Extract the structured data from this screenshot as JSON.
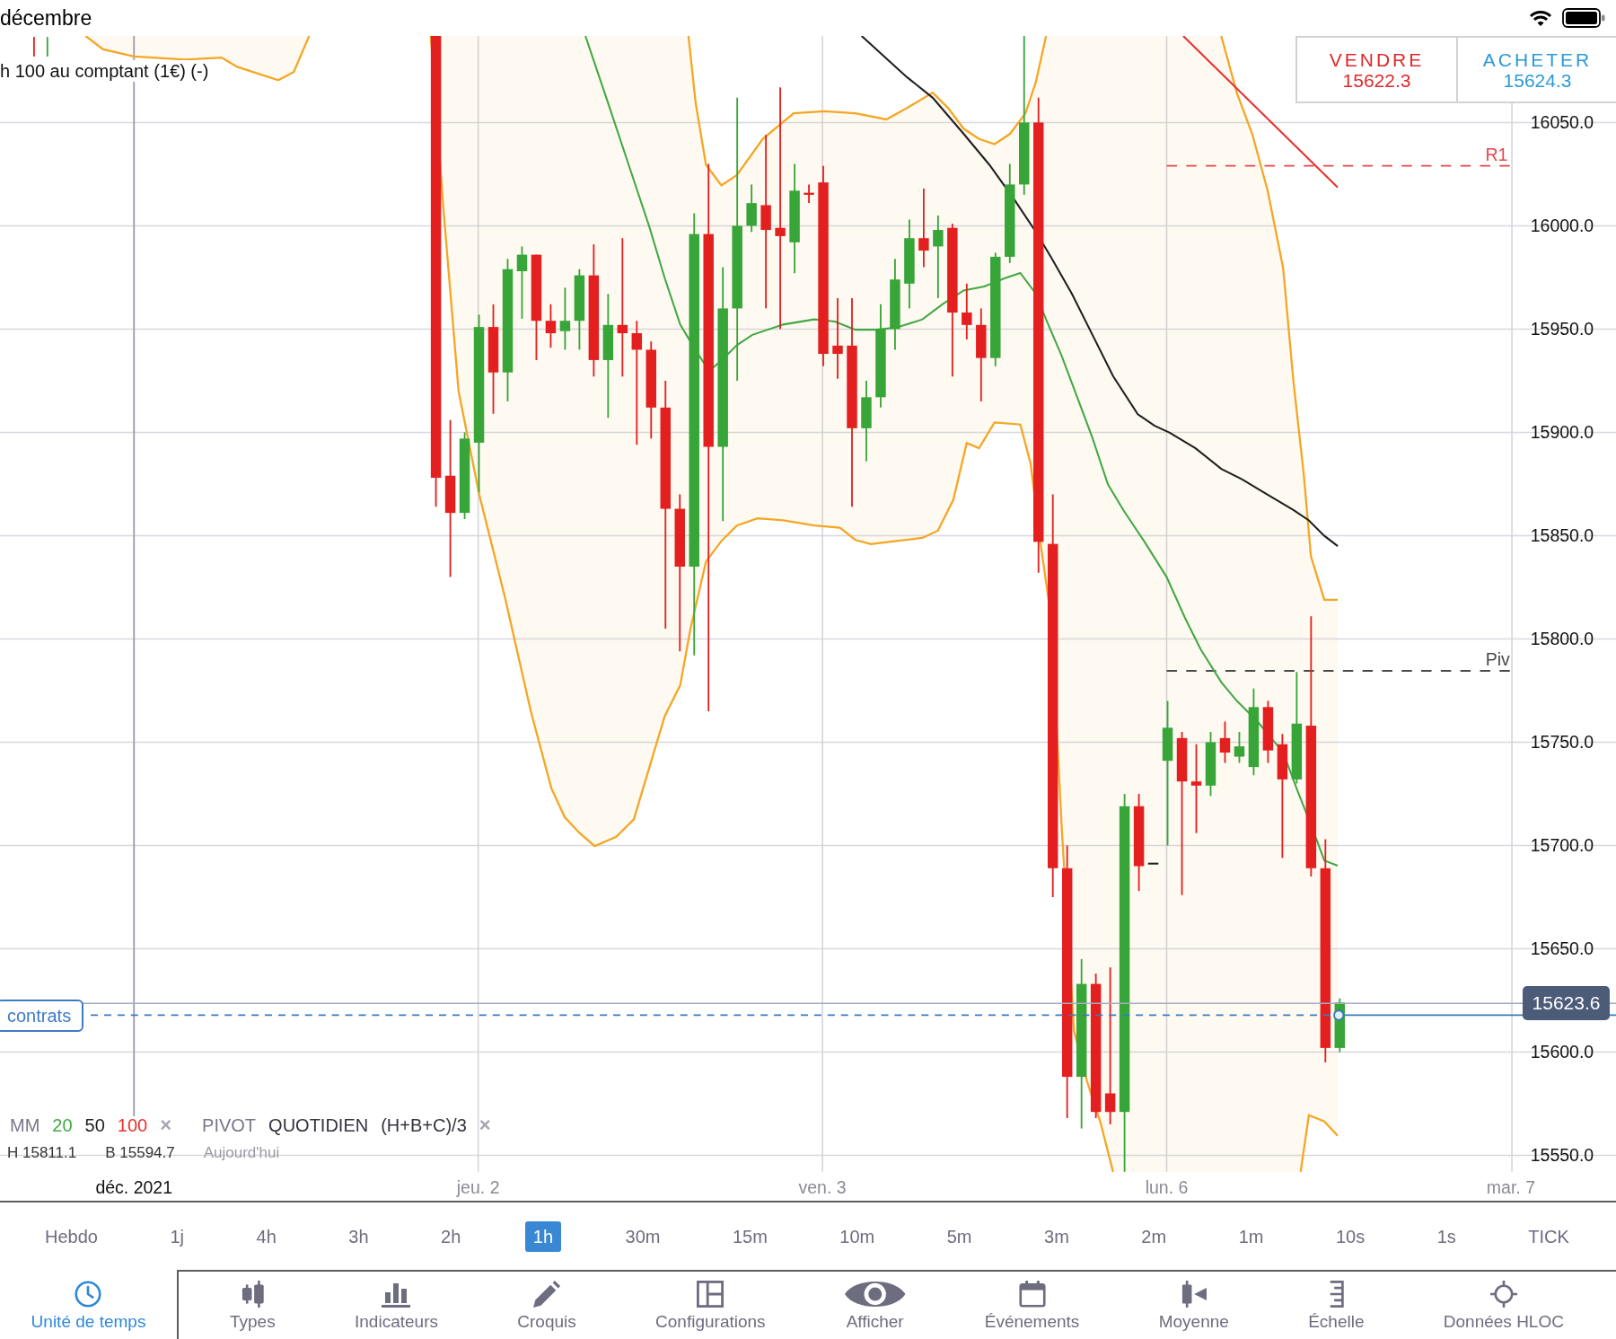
{
  "status_bar": {
    "title": "décembre"
  },
  "chart": {
    "instrument": "h 100 au comptant (1€) (-)",
    "quotes": [
      {
        "kind": "sell",
        "label": "VENDRE",
        "price": "15622.3"
      },
      {
        "kind": "buy",
        "label": "ACHETER",
        "price": "15624.3"
      }
    ],
    "price_axis": [
      "16050.0",
      "16000.0",
      "15950.0",
      "15900.0",
      "15850.0",
      "15800.0",
      "15750.0",
      "15700.0",
      "15650.0",
      "15600.0",
      "15550.0"
    ],
    "pivot_lines": [
      {
        "label": "R1",
        "color": "#e5484d"
      },
      {
        "label": "Piv",
        "color": "#4a4a4a"
      }
    ],
    "last_price": "15623.6",
    "position": {
      "label": "contrats"
    },
    "indicators": [
      {
        "label": "MM",
        "params": [
          {
            "text": "20",
            "color": "#43a843"
          },
          {
            "text": "50",
            "color": "#1f1f1f"
          },
          {
            "text": "100",
            "color": "#e8312f"
          }
        ],
        "remove": "×"
      },
      {
        "label": "PIVOT",
        "params": [
          {
            "text": "QUOTIDIEN"
          },
          {
            "text": "(H+B+C)/3"
          }
        ],
        "remove": "×"
      }
    ],
    "stats": [
      {
        "kind": "value",
        "text": "H 15811.1"
      },
      {
        "kind": "value",
        "text": "B 15594.7"
      },
      {
        "kind": "period",
        "text": "Aujourd'hui"
      }
    ],
    "time_axis": [
      {
        "kind": "month",
        "label": "déc. 2021"
      },
      {
        "kind": "day",
        "label": "jeu. 2"
      },
      {
        "kind": "day",
        "label": "ven. 3"
      },
      {
        "kind": "day",
        "label": "lun. 6"
      },
      {
        "kind": "day",
        "label": "mar. 7"
      }
    ]
  },
  "timeframes": [
    {
      "label": "Hebdo",
      "selected": false
    },
    {
      "label": "1j",
      "selected": false
    },
    {
      "label": "4h",
      "selected": false
    },
    {
      "label": "3h",
      "selected": false
    },
    {
      "label": "2h",
      "selected": false
    },
    {
      "label": "1h",
      "selected": true
    },
    {
      "label": "30m",
      "selected": false
    },
    {
      "label": "15m",
      "selected": false
    },
    {
      "label": "10m",
      "selected": false
    },
    {
      "label": "5m",
      "selected": false
    },
    {
      "label": "3m",
      "selected": false
    },
    {
      "label": "2m",
      "selected": false
    },
    {
      "label": "1m",
      "selected": false
    },
    {
      "label": "10s",
      "selected": false
    },
    {
      "label": "1s",
      "selected": false
    },
    {
      "label": "TICK",
      "selected": false
    }
  ],
  "toolbar": [
    {
      "label": "Unité de temps",
      "selected": true
    },
    {
      "label": "Types",
      "selected": false
    },
    {
      "label": "Indicateurs",
      "selected": false
    },
    {
      "label": "Croquis",
      "selected": false
    },
    {
      "label": "Configurations",
      "selected": false
    },
    {
      "label": "Afficher",
      "selected": false
    },
    {
      "label": "Événements",
      "selected": false
    },
    {
      "label": "Moyenne",
      "selected": false
    },
    {
      "label": "Échelle",
      "selected": false
    },
    {
      "label": "Données HLOC",
      "selected": false
    }
  ]
}
